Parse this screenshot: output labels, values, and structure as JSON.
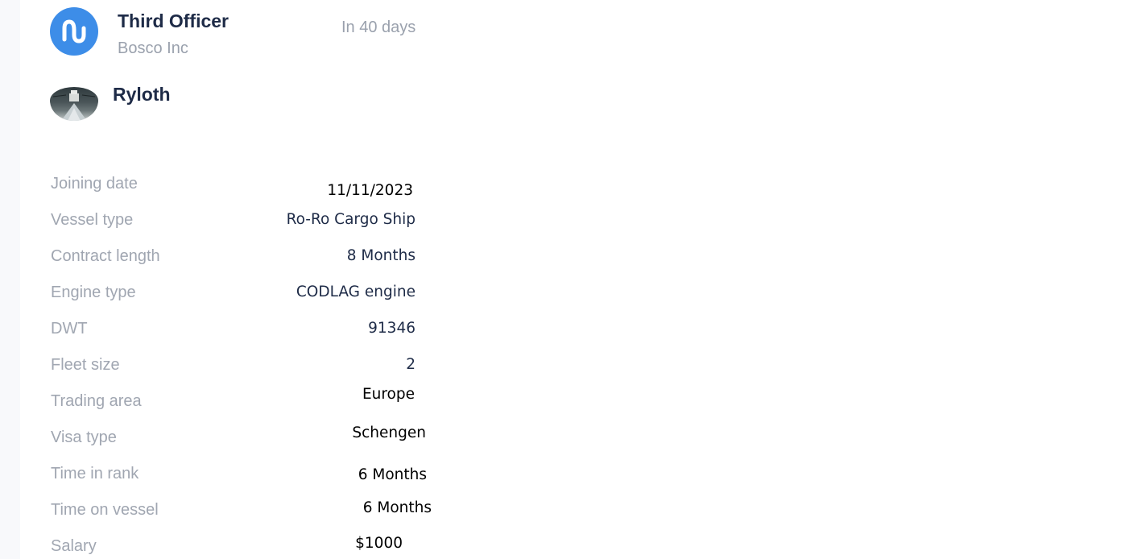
{
  "job": {
    "title": "Third Officer",
    "company": "Bosco Inc",
    "due": "In 40 days",
    "logo_icon": "company-logo-m-wave",
    "logo_color": "#3d8de8"
  },
  "vessel": {
    "name": "Ryloth",
    "photo_icon": "vessel-photo"
  },
  "details": [
    {
      "label": "Joining date",
      "value": "11/11/2023"
    },
    {
      "label": "Vessel type",
      "value": "Ro-Ro Cargo Ship"
    },
    {
      "label": "Contract length",
      "value": "8 Months"
    },
    {
      "label": "Engine type",
      "value": "CODLAG engine"
    },
    {
      "label": "DWT",
      "value": "91346"
    },
    {
      "label": "Fleet size",
      "value": "2"
    },
    {
      "label": "Trading area",
      "value": "Europe"
    },
    {
      "label": "Visa type",
      "value": "Schengen"
    },
    {
      "label": "Time in rank",
      "value": "6 Months"
    },
    {
      "label": "Time on vessel",
      "value": "6 Months"
    },
    {
      "label": "Salary",
      "value": "$1000"
    }
  ],
  "colors": {
    "title": "#1e2b47",
    "muted": "#9aa1ad",
    "sidebar_bg": "#f8f9fb"
  }
}
